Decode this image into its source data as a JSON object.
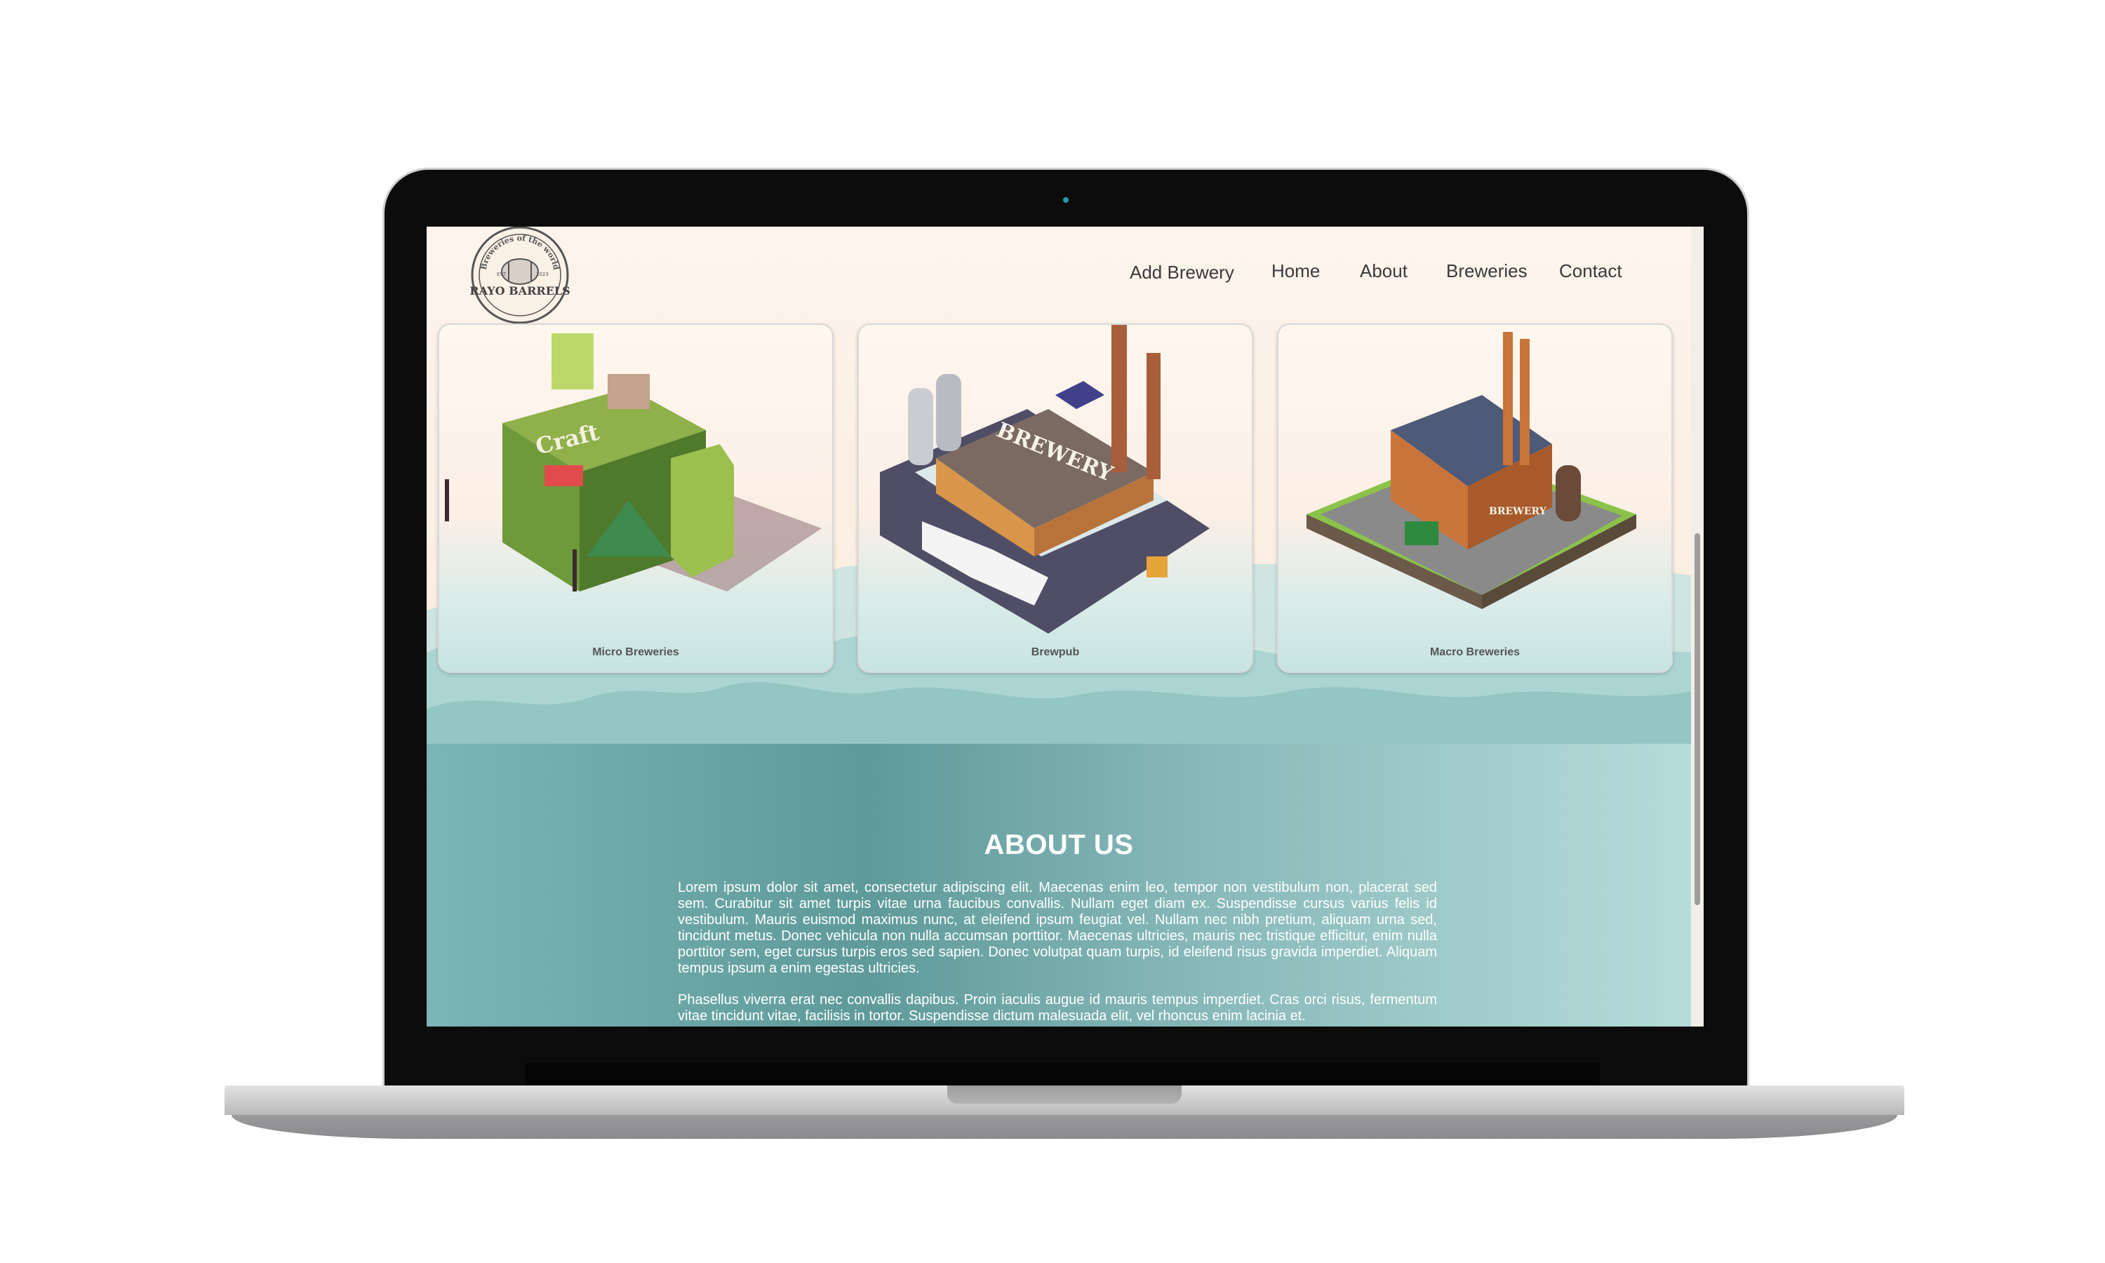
{
  "brand": {
    "logo_name": "RAYO BARRELS",
    "logo_tagline": "Breweries of the world",
    "logo_est": "EST",
    "logo_year": "2023"
  },
  "nav": {
    "items": [
      {
        "label": "Add Brewery"
      },
      {
        "label": "Home"
      },
      {
        "label": "About"
      },
      {
        "label": "Breweries"
      },
      {
        "label": "Contact"
      }
    ]
  },
  "cards": [
    {
      "label": "Micro Breweries",
      "sign": "Craft"
    },
    {
      "label": "Brewpub",
      "sign": "BREWERY"
    },
    {
      "label": "Macro Breweries",
      "sign": "BREWERY"
    }
  ],
  "about": {
    "title": "ABOUT US",
    "paragraphs": [
      "Lorem ipsum dolor sit amet, consectetur adipiscing elit. Maecenas enim leo, tempor non vestibulum non, placerat sed sem. Curabitur sit amet turpis vitae urna faucibus convallis. Nullam eget diam ex. Suspendisse cursus varius felis id vestibulum. Mauris euismod maximus nunc, at eleifend ipsum feugiat vel. Nullam nec nibh pretium, aliquam urna sed, tincidunt metus. Donec vehicula non nulla accumsan porttitor. Maecenas ultricies, mauris nec tristique efficitur, enim nulla porttitor sem, eget cursus turpis eros sed sapien. Donec volutpat quam turpis, id eleifend risus gravida imperdiet. Aliquam tempus ipsum a enim egestas ultricies.",
      "Phasellus viverra erat nec convallis dapibus. Proin iaculis augue id mauris tempus imperdiet. Cras orci risus, fermentum vitae tincidunt vitae, facilisis in tortor. Suspendisse dictum malesuada elit, vel rhoncus enim lacinia et."
    ]
  },
  "colors": {
    "accent_teal": "#5f9a9a",
    "hero_background": "#fdf4ec",
    "text_light": "#ffffff"
  }
}
